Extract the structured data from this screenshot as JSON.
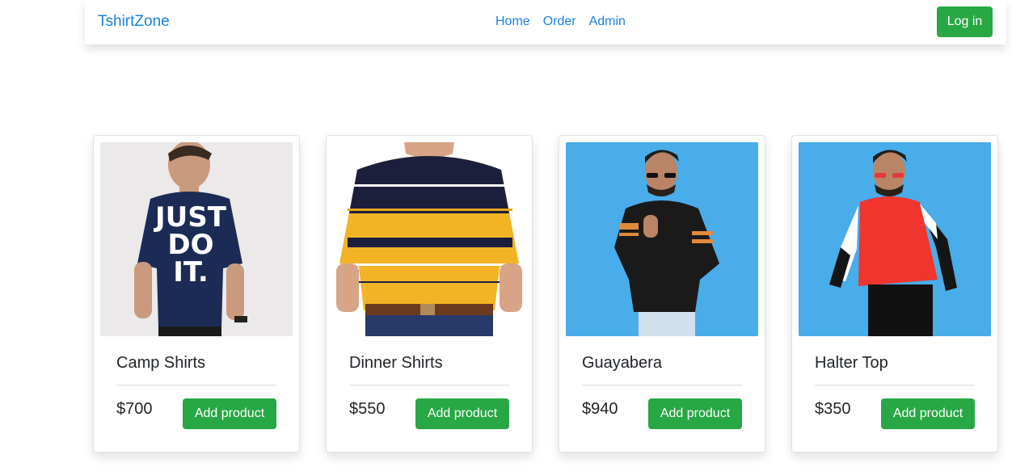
{
  "navbar": {
    "brand": "TshirtZone",
    "links": [
      "Home",
      "Order",
      "Admin"
    ],
    "login_label": "Log in"
  },
  "colors": {
    "accent": "#1a82e2",
    "button": "#28a745"
  },
  "products": [
    {
      "name": "Camp Shirts",
      "price": "$700",
      "button_label": "Add product",
      "image_overlay_text": [
        "JUST",
        "DO",
        "IT."
      ]
    },
    {
      "name": "Dinner Shirts",
      "price": "$550",
      "button_label": "Add product"
    },
    {
      "name": "Guayabera",
      "price": "$940",
      "button_label": "Add product"
    },
    {
      "name": "Halter Top",
      "price": "$350",
      "button_label": "Add product"
    }
  ]
}
